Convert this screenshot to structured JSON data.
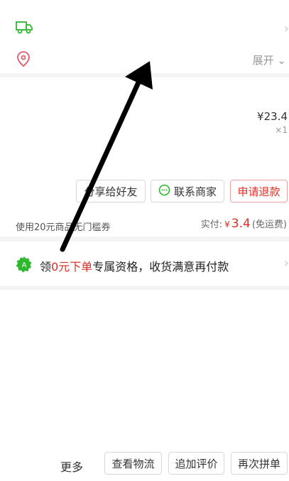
{
  "order": {
    "expand_label": "展开",
    "price": "¥23.4",
    "quantity": "×1"
  },
  "actions": {
    "share_label": "分享给好友",
    "contact_label": "联系商家",
    "refund_label": "申请退款"
  },
  "payment": {
    "coupon_text": "使用20元商品无门槛券",
    "paid_label": "实付:",
    "currency": "¥",
    "paid_amount": "3.4",
    "shipping_note": "(免运费)"
  },
  "promo": {
    "prefix": "领",
    "highlight": "0元下单",
    "suffix": "专属资格，收货满意再付款"
  },
  "bottom_bar": {
    "more_label": "更多",
    "logistics_label": "查看物流",
    "review_label": "追加评价",
    "regroup_label": "再次拼单"
  },
  "icons": {
    "truck": "truck-icon",
    "location": "location-pin-icon",
    "chat": "chat-bubble-icon",
    "promo": "gift-badge-icon",
    "arrow": "annotation-arrow"
  },
  "colors": {
    "accent_red": "#e02e24",
    "green": "#2eb82e",
    "pink": "#e05a6a"
  }
}
